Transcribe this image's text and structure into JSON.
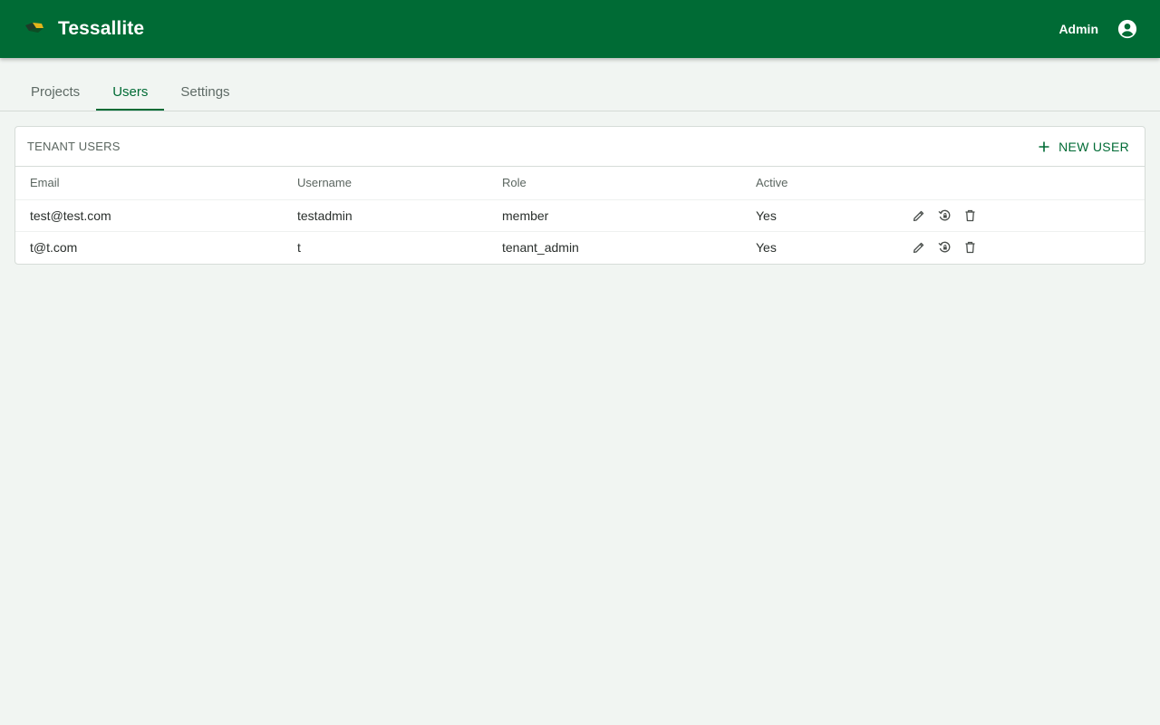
{
  "app": {
    "name": "Tessallite",
    "user_label": "Admin",
    "brand_color": "#006b35",
    "logo_icon": "tessallite-logo-icon",
    "account_icon": "account-circle-icon"
  },
  "tabs": [
    {
      "label": "Projects",
      "active": false
    },
    {
      "label": "Users",
      "active": true
    },
    {
      "label": "Settings",
      "active": false
    }
  ],
  "users_card": {
    "title": "TENANT USERS",
    "new_user_label": "NEW USER",
    "new_user_icon": "plus-icon",
    "columns": {
      "email": "Email",
      "username": "Username",
      "role": "Role",
      "active": "Active"
    },
    "rows": [
      {
        "email": "test@test.com",
        "username": "testadmin",
        "role": "member",
        "active": "Yes"
      },
      {
        "email": "t@t.com",
        "username": "t",
        "role": "tenant_admin",
        "active": "Yes"
      }
    ],
    "row_action_icons": [
      "edit-icon",
      "reset-password-icon",
      "delete-icon"
    ]
  }
}
